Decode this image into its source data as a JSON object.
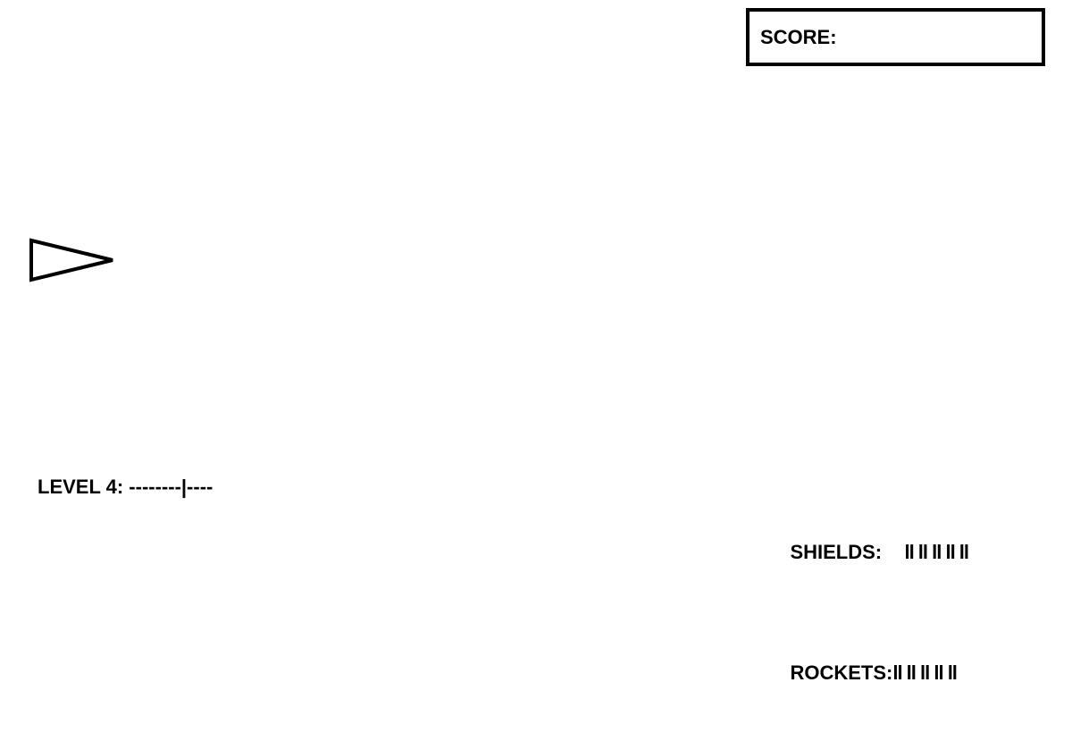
{
  "score": {
    "label": "SCORE:",
    "value": ""
  },
  "player": {
    "icon": "ship-triangle-icon",
    "color": "#000000"
  },
  "level": {
    "text": "LEVEL 4: --------|----"
  },
  "shields": {
    "label": "SHIELDS:",
    "bars": "ll ll ll ll ll"
  },
  "rockets": {
    "label": "ROCKETS:",
    "bars": "ll ll ll ll ll"
  }
}
